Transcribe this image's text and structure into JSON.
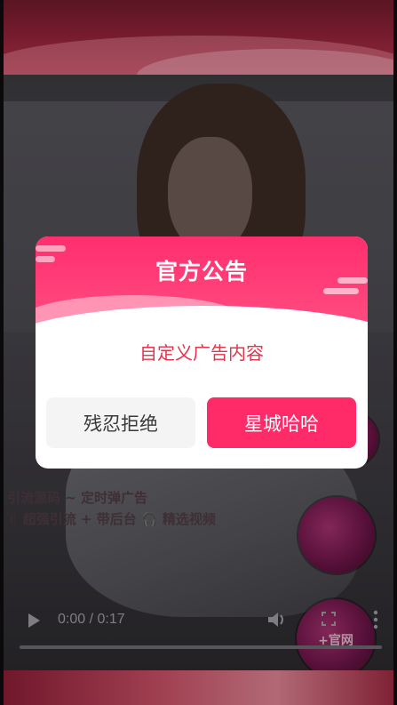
{
  "video": {
    "ad_text": "引流源码 ~ 定时弹广告\n✌ 超强引流 + 带后台 🎧 精选视频",
    "floating_ball_label": "+官网",
    "time_display": "0:00 / 0:17"
  },
  "dialog": {
    "title": "官方公告",
    "message": "自定义广告内容",
    "reject_label": "残忍拒绝",
    "accept_label": "星城哈哈"
  },
  "icons": {
    "play": "play-icon",
    "volume": "volume-icon",
    "fullscreen": "fullscreen-icon",
    "more": "more-vertical-icon"
  },
  "colors": {
    "accent": "#ff2a68",
    "header_top": "#ff2e6e",
    "message_text": "#e5344a",
    "reject_bg": "#f4f4f4"
  }
}
